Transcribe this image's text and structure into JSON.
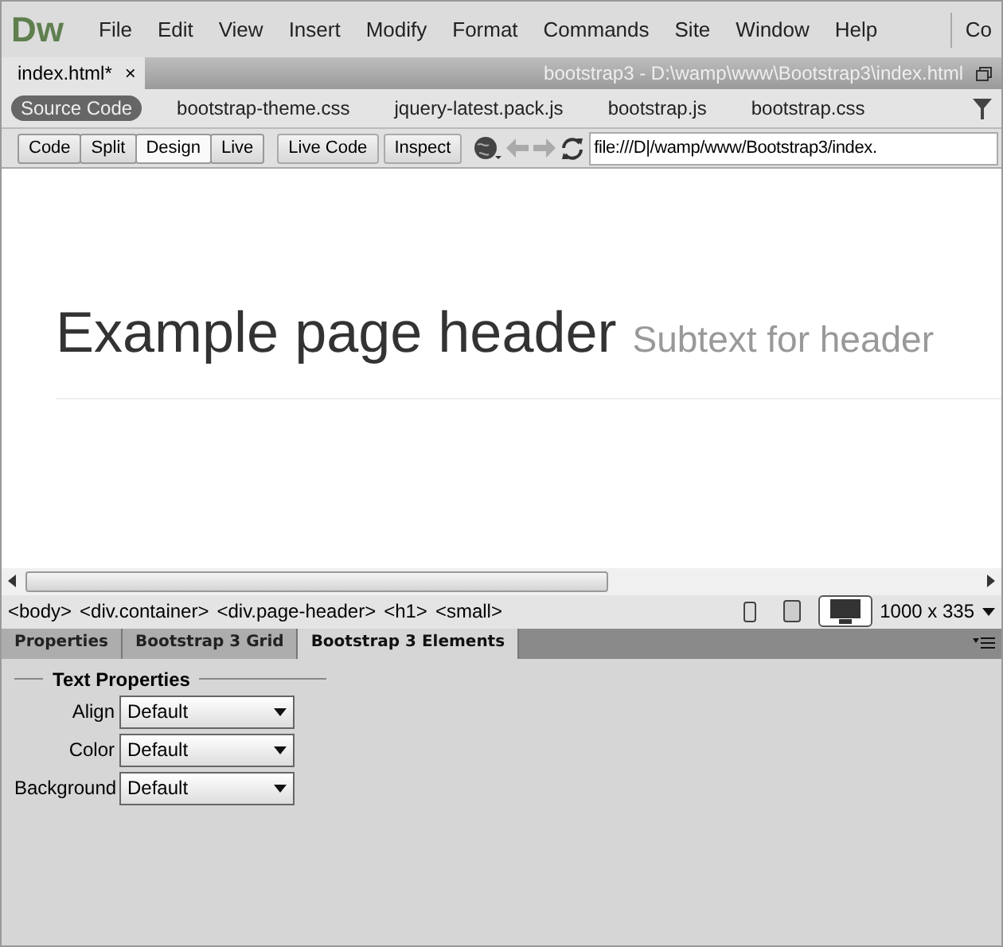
{
  "app_logo": "Dw",
  "menu": [
    "File",
    "Edit",
    "View",
    "Insert",
    "Modify",
    "Format",
    "Commands",
    "Site",
    "Window",
    "Help"
  ],
  "menu_cut": "Co",
  "document_tab": {
    "label": "index.html*",
    "close": "×"
  },
  "document_path": "bootstrap3 - D:\\wamp\\www\\Bootstrap3\\index.html",
  "related_files": [
    {
      "label": "Source Code",
      "selected": true
    },
    {
      "label": "bootstrap-theme.css",
      "selected": false
    },
    {
      "label": "jquery-latest.pack.js",
      "selected": false
    },
    {
      "label": "bootstrap.js",
      "selected": false
    },
    {
      "label": "bootstrap.css",
      "selected": false
    }
  ],
  "view_buttons": [
    {
      "label": "Code",
      "selected": false
    },
    {
      "label": "Split",
      "selected": false
    },
    {
      "label": "Design",
      "selected": true
    },
    {
      "label": "Live",
      "selected": false
    }
  ],
  "live_buttons": [
    "Live Code",
    "Inspect"
  ],
  "address": "file:///D|/wamp/www/Bootstrap3/index.",
  "page": {
    "heading": "Example page header",
    "subtext": "Subtext for header"
  },
  "tag_selector": [
    "<body>",
    "<div.container>",
    "<div.page-header>",
    "<h1>",
    "<small>"
  ],
  "devices": [
    {
      "kind": "phone",
      "selected": false
    },
    {
      "kind": "tablet",
      "selected": false
    },
    {
      "kind": "desktop",
      "selected": true
    }
  ],
  "window_size": "1000 x 335",
  "panel_tabs": [
    {
      "label": "Properties",
      "selected": false
    },
    {
      "label": "Bootstrap 3 Grid",
      "selected": false
    },
    {
      "label": "Bootstrap 3 Elements",
      "selected": true
    }
  ],
  "section_title": "Text Properties",
  "fields": [
    {
      "label": "Align",
      "value": "Default"
    },
    {
      "label": "Color",
      "value": "Default"
    },
    {
      "label": "Background",
      "value": "Default"
    }
  ]
}
